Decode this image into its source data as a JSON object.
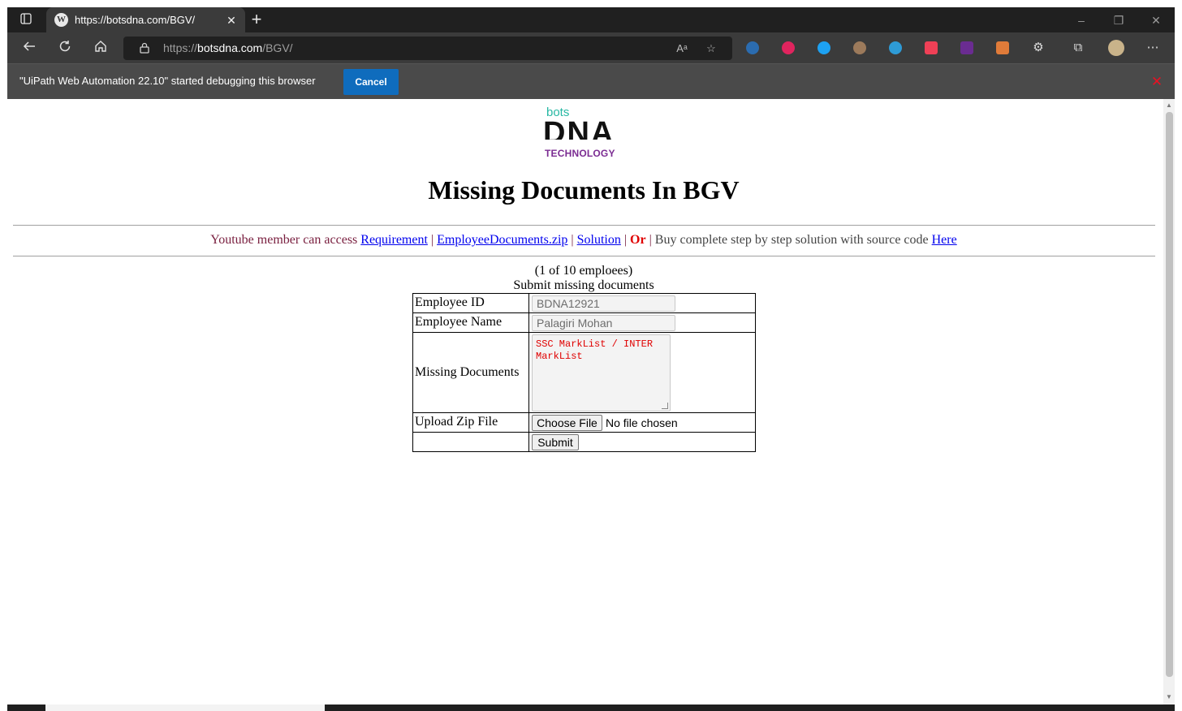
{
  "browser": {
    "tab": {
      "title": "https://botsdna.com/BGV/"
    },
    "address": {
      "scheme": "https://",
      "host": "botsdna.com",
      "path": "/BGV/"
    },
    "infobar": {
      "message": "\"UiPath Web Automation 22.10\" started debugging this browser",
      "cancel_label": "Cancel"
    },
    "read_aloud_glyph": "Aᵃ",
    "extensions": [
      {
        "name": "ext-1",
        "color": "#2b6cb0"
      },
      {
        "name": "ext-2",
        "color": "#e0245e"
      },
      {
        "name": "ext-3",
        "color": "#1da1f2"
      },
      {
        "name": "ext-4",
        "color": "#9c7a5b"
      },
      {
        "name": "ext-5",
        "color": "#2e9bd6"
      },
      {
        "name": "ext-6",
        "color": "#ef4056"
      },
      {
        "name": "ext-7",
        "color": "#6a2c91"
      },
      {
        "name": "ext-8",
        "color": "#e07b39"
      }
    ],
    "colors": {
      "tabstrip": "#202020",
      "toolbar": "#3b3b3b",
      "infobar": "#4a4a4a",
      "cancel_button": "#0f6cbd"
    }
  },
  "page": {
    "logo": {
      "top_word": "bots",
      "main_word": "DNA",
      "bottom_word": "TECHNOLOGY"
    },
    "heading": "Missing Documents In BGV",
    "linkbar": {
      "prefix": "Youtube member can access ",
      "links": [
        "Requirement",
        "EmployeeDocuments.zip",
        "Solution"
      ],
      "separator": "|",
      "or_label": "Or",
      "buy_text": " Buy complete step by step solution with source code ",
      "here_label": "Here"
    },
    "counter": "(1 of 10 emploees)",
    "subtitle": "Submit missing documents",
    "form": {
      "employee_id": {
        "label": "Employee ID",
        "value": "BDNA12921"
      },
      "employee_name": {
        "label": "Employee Name",
        "value": "Palagiri Mohan"
      },
      "missing_documents": {
        "label": "Missing Documents",
        "value": "SSC MarkList / INTER MarkList"
      },
      "upload": {
        "label": "Upload Zip File",
        "button_label": "Choose File",
        "status": "No file chosen"
      },
      "submit_label": "Submit"
    }
  }
}
